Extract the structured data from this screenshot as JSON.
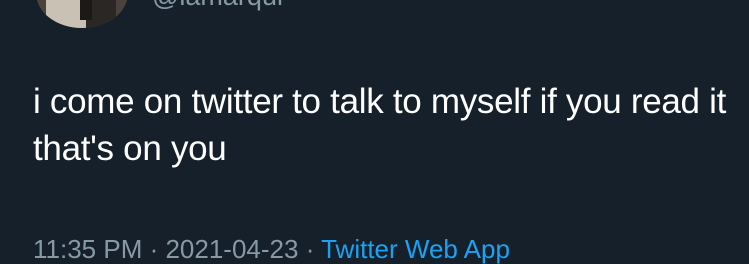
{
  "tweet": {
    "handle": "@lamarqui",
    "text": "i come on twitter to talk to myself if you read it that's on you",
    "timestamp": "11:35 PM · 2021-04-23",
    "separator": " · ",
    "source": "Twitter Web App"
  },
  "colors": {
    "background": "#15202b",
    "text": "#ffffff",
    "secondary": "#8899a6",
    "link": "#1da1f2"
  },
  "icons": {
    "avatar": "profile-photo"
  }
}
